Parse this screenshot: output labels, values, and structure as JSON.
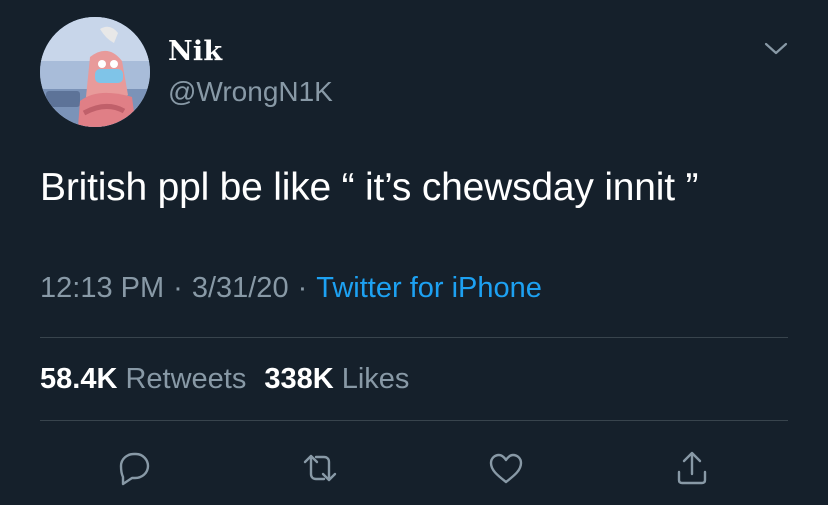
{
  "user": {
    "display_name": "Nik",
    "handle": "@WrongN1K"
  },
  "tweet": {
    "text": "British ppl be like “ it’s chewsday innit ”",
    "time": "12:13 PM",
    "date": "3/31/20",
    "separator": "·",
    "source": "Twitter for iPhone"
  },
  "stats": {
    "retweets_count": "58.4K",
    "retweets_label": "Retweets",
    "likes_count": "338K",
    "likes_label": "Likes"
  },
  "icons": {
    "menu": "chevron-down-icon",
    "reply": "reply-icon",
    "retweet": "retweet-icon",
    "like": "heart-icon",
    "share": "share-icon"
  },
  "colors": {
    "background": "#15202b",
    "secondary_text": "#8899a6",
    "accent": "#1da1f2",
    "divider": "#38444d"
  }
}
